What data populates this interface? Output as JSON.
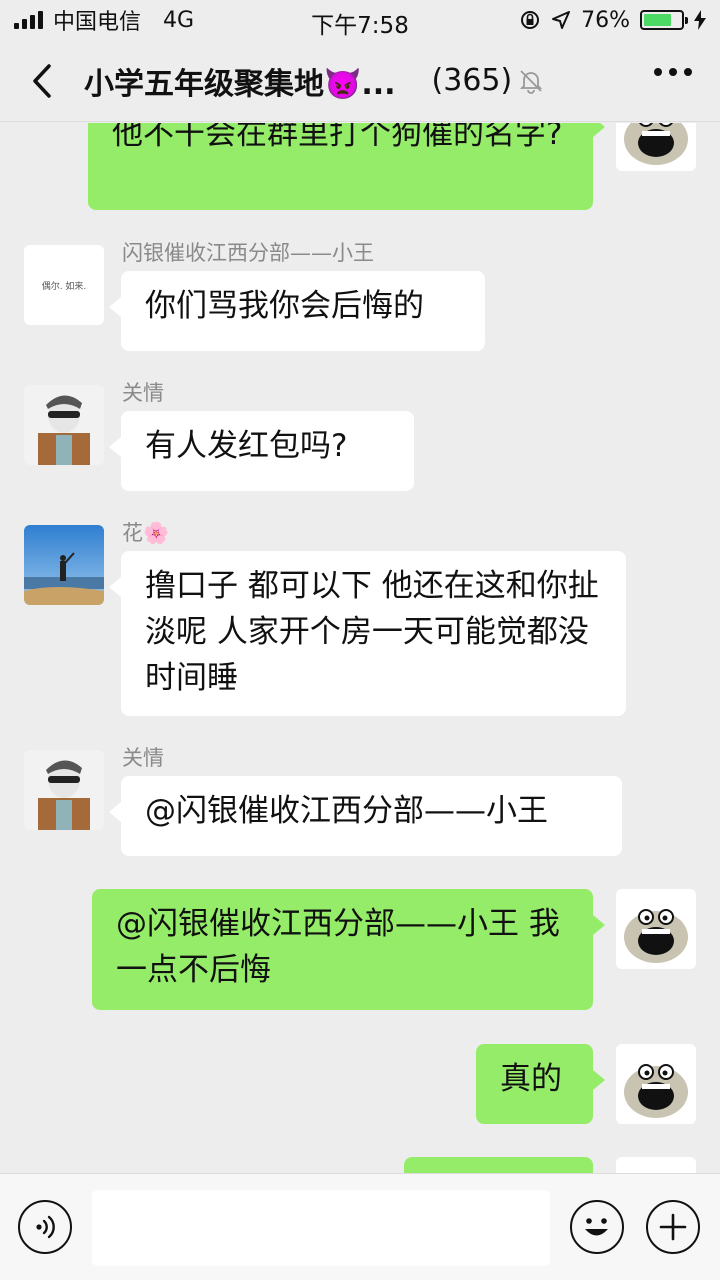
{
  "status_bar": {
    "carrier": "中国电信",
    "network": "4G",
    "time": "下午7:58",
    "battery": "76%",
    "battery_level": 0.76
  },
  "nav": {
    "title": "小学五年级聚集地👿...",
    "count": "(365)"
  },
  "messages": [
    {
      "direction": "out",
      "text": "他不干会在群里打个狗催的名字?"
    },
    {
      "direction": "in",
      "sender": "闪银催收江西分部——小王",
      "text": "你们骂我你会后悔的"
    },
    {
      "direction": "in",
      "sender": "关情",
      "text": "有人发红包吗?"
    },
    {
      "direction": "in",
      "sender": "花🌸",
      "text": "撸口子  都可以下  他还在这和你扯淡呢   人家开个房一天可能觉都没时间睡"
    },
    {
      "direction": "in",
      "sender": "关情",
      "text": "@闪银催收江西分部——小王"
    },
    {
      "direction": "out",
      "text": "@闪银催收江西分部——小王 我一点不后悔"
    },
    {
      "direction": "out",
      "text": "真的"
    }
  ],
  "avatar_texts": {
    "xiaowang": "偶尔. 如来."
  },
  "input": {
    "placeholder": ""
  },
  "colors": {
    "outgoing_bubble": "#95ec69",
    "incoming_bubble": "#ffffff",
    "background": "#ededed"
  }
}
